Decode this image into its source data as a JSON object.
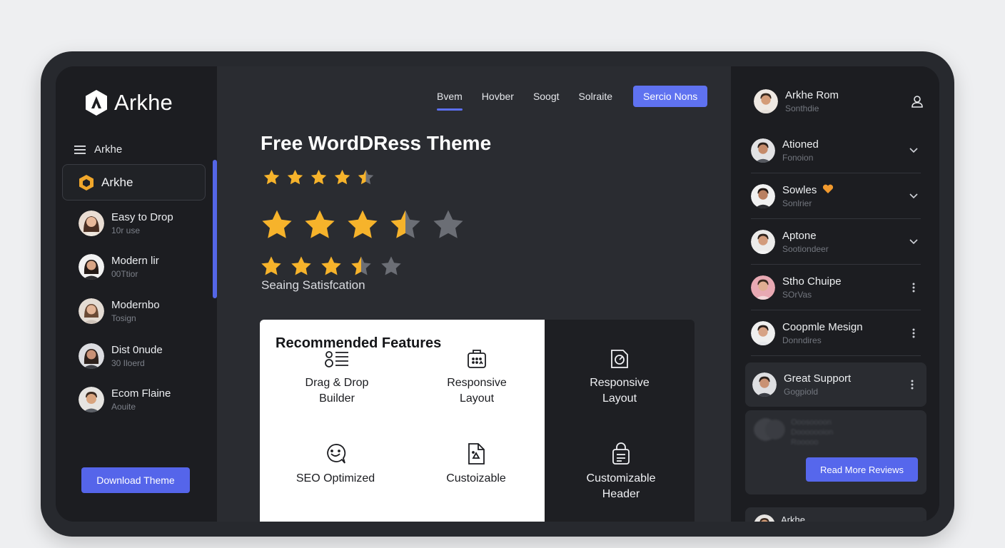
{
  "brand": {
    "name": "Arkhe"
  },
  "sidebar": {
    "menu_label": "Arkhe",
    "active_item": "Arkhe",
    "items": [
      {
        "title": "Easy to Drop",
        "subtitle": "10r use"
      },
      {
        "title": "Modern lir",
        "subtitle": "00Ttior"
      },
      {
        "title": "Modernbo",
        "subtitle": "Tosign"
      },
      {
        "title": "Dist 0nude",
        "subtitle": "30 Iloerd"
      },
      {
        "title": "Ecom Flaine",
        "subtitle": "Aouite"
      }
    ],
    "download_label": "Download Theme"
  },
  "nav": {
    "links": [
      "Bvem",
      "Hovber",
      "Soogt",
      "Solraite"
    ],
    "cta_label": "Sercio Nons"
  },
  "hero": {
    "title": "Free WordDRess Theme",
    "satisfaction": "Seaing Satisfcation",
    "ratings": [
      {
        "value": 4.5,
        "max": 5,
        "filled_count": 4
      },
      {
        "value": 3.5,
        "max": 5,
        "filled_count": 3
      },
      {
        "value": 3.5,
        "max": 5,
        "filled_count": 3
      }
    ]
  },
  "features": {
    "title": "Recommended Features",
    "items": [
      {
        "label": "Drag & Drop\nBuilder",
        "icon": "list-drag-icon"
      },
      {
        "label": "Responsive\nLayout",
        "icon": "calendar-grid-icon"
      },
      {
        "label": "Responsive\nLayout",
        "icon": "image-frame-icon"
      },
      {
        "label": "SEO Optimized",
        "icon": "chat-smile-icon"
      },
      {
        "label": "Custoizable",
        "icon": "document-icon"
      },
      {
        "label": "Customizable\nHeader",
        "icon": "lock-doc-icon"
      }
    ]
  },
  "reviews": {
    "header": {
      "name": "Arkhe Rom",
      "subtitle": "Sonthdie"
    },
    "items": [
      {
        "title": "Ationed",
        "subtitle": "Fonoion",
        "action": "chevron"
      },
      {
        "title": "Sowles",
        "subtitle": "Sonlrier",
        "action": "chevron",
        "badge": "heart-icon"
      },
      {
        "title": "Aptone",
        "subtitle": "Sootiondeer",
        "action": "chevron"
      },
      {
        "title": "Stho Chuipe",
        "subtitle": "SOrVas",
        "action": "dots"
      },
      {
        "title": "Coopmle Mesign",
        "subtitle": "Donndires",
        "action": "dots"
      }
    ],
    "card": {
      "title": "Great Support",
      "subtitle": "Gogpiold"
    },
    "blurred_lines": [
      "Ooosoooon",
      "Dooooooion",
      "Rooooo"
    ],
    "read_more_label": "Read More Reviews",
    "bottom_label": "Arkhe"
  },
  "colors": {
    "accent": "#5a6cee",
    "star": "#f6b32b",
    "star_empty": "#6b6e75",
    "bg_dark": "#1c1d21",
    "bg_main": "#2a2c31"
  }
}
